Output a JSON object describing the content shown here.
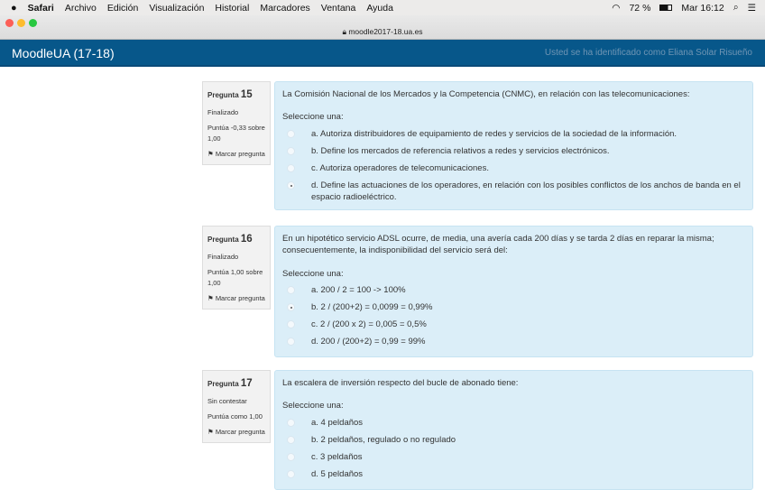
{
  "menubar": {
    "apple": "",
    "app": "Safari",
    "items": [
      "Archivo",
      "Edición",
      "Visualización",
      "Historial",
      "Marcadores",
      "Ventana",
      "Ayuda"
    ],
    "battery": "72 %",
    "clock": "Mar 16:12"
  },
  "browser": {
    "url": "moodle2017-18.ua.es"
  },
  "header": {
    "brand": "MoodleUA (17-18)",
    "login": "Usted se ha identificado como Eliana Solar Risueño"
  },
  "questions": [
    {
      "label": "Pregunta",
      "number": "15",
      "state": "Finalizado",
      "grade": "Puntúa -0,33 sobre 1,00",
      "flag": "Marcar pregunta",
      "text": "La Comisión Nacional de los Mercados y la Competencia (CNMC), en relación con las telecomunicaciones:",
      "prompt": "Seleccione una:",
      "options": [
        "a. Autoriza distribuidores de equipamiento de redes y servicios de la sociedad de la información.",
        "b. Define los mercados de referencia relativos a redes y servicios electrónicos.",
        "c. Autoriza operadores de telecomunicaciones.",
        "d. Define las actuaciones de los operadores, en relación con los posibles conflictos de los anchos de banda en el espacio radioeléctrico."
      ],
      "selected": 3
    },
    {
      "label": "Pregunta",
      "number": "16",
      "state": "Finalizado",
      "grade": "Puntúa 1,00 sobre 1,00",
      "flag": "Marcar pregunta",
      "text": "En un hipotético servicio ADSL ocurre, de media, una avería cada 200 días y se tarda 2 días en reparar la misma; consecuentemente, la indisponibilidad del servicio será del:",
      "prompt": "Seleccione una:",
      "options": [
        "a. 200 / 2 = 100 -> 100%",
        "b. 2 / (200+2) = 0,0099 = 0,99%",
        "c. 2 / (200 x 2) = 0,005 = 0,5%",
        "d. 200 / (200+2) = 0,99 = 99%"
      ],
      "selected": 1
    },
    {
      "label": "Pregunta",
      "number": "17",
      "state": "Sin contestar",
      "grade": "Puntúa como 1,00",
      "flag": "Marcar pregunta",
      "text": "La escalera de inversión respecto del bucle de abonado tiene:",
      "prompt": "Seleccione una:",
      "options": [
        "a. 4 peldaños",
        "b. 2 peldaños, regulado o no regulado",
        "c. 3 peldaños",
        "d. 5 peldaños"
      ],
      "selected": null
    }
  ]
}
